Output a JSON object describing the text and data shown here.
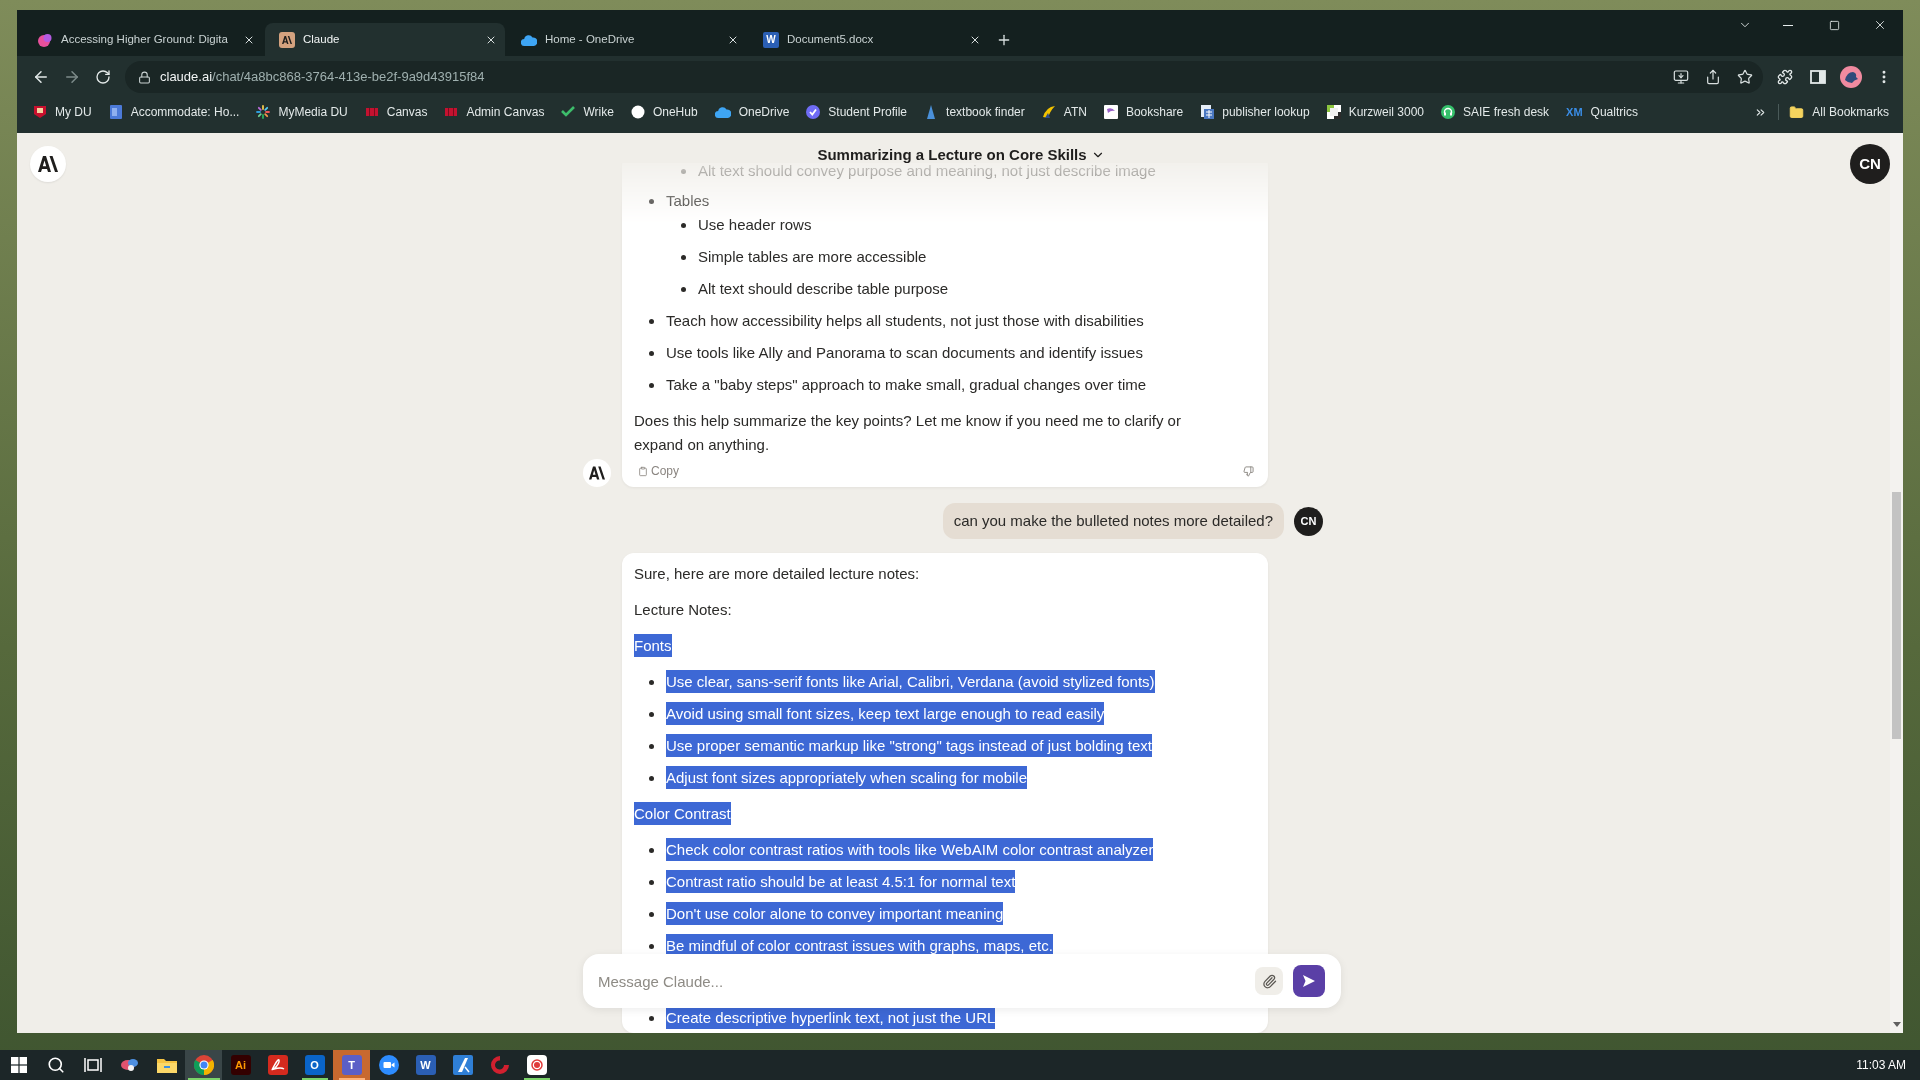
{
  "browser": {
    "tabs": [
      {
        "title": "Accessing Higher Ground: Digita",
        "selected": false
      },
      {
        "title": "Claude",
        "selected": true
      },
      {
        "title": "Home - OneDrive",
        "selected": false
      },
      {
        "title": "Document5.docx",
        "glyph": "W",
        "selected": false
      }
    ],
    "forward_disabled": true,
    "address_bar": {
      "host": "claude.ai",
      "path": "/chat/4a8bc868-3764-413e-be2f-9a9d43915f84"
    },
    "bookmarks": [
      {
        "label": "My DU"
      },
      {
        "label": "Accommodate: Ho..."
      },
      {
        "label": "MyMedia DU"
      },
      {
        "label": "Canvas"
      },
      {
        "label": "Admin Canvas"
      },
      {
        "label": "Wrike"
      },
      {
        "label": "OneHub"
      },
      {
        "label": "OneDrive"
      },
      {
        "label": "Student Profile"
      },
      {
        "label": "textbook finder"
      },
      {
        "label": "ATN"
      },
      {
        "label": "Bookshare"
      },
      {
        "label": "publisher lookup"
      },
      {
        "label": "Kurzweil 3000"
      },
      {
        "label": "SAIE fresh desk"
      },
      {
        "label": "Qualtrics",
        "glyph": "XM"
      }
    ],
    "all_bookmarks": "All Bookmarks"
  },
  "chat": {
    "title": "Summarizing a Lecture on Core Skills",
    "profile_initials": "CN",
    "messages": [
      {
        "kind": "assistant",
        "blocks": [
          {
            "kind": "list",
            "items": [
              {
                "children": [
                  {
                    "text": "Alt text should convey purpose and meaning, not just describe image"
                  }
                ]
              },
              {
                "text": "Tables",
                "children": [
                  {
                    "text": "Use header rows"
                  },
                  {
                    "text": "Simple tables are more accessible"
                  },
                  {
                    "text": "Alt text should describe table purpose"
                  }
                ]
              },
              {
                "text": "Teach how accessibility helps all students, not just those with disabilities"
              },
              {
                "text": "Use tools like Ally and Panorama to scan documents and identify issues"
              },
              {
                "text": "Take a \"baby steps\" approach to make small, gradual changes over time"
              }
            ]
          },
          {
            "kind": "paragraph",
            "text": "Does this help summarize the key points? Let me know if you need me to clarify or expand on anything."
          }
        ],
        "copy_label": "Copy"
      },
      {
        "kind": "user",
        "text": "can you make the bulleted notes more detailed?",
        "initials": "CN"
      },
      {
        "kind": "assistant",
        "blocks": [
          {
            "kind": "paragraph",
            "text": "Sure, here are more detailed lecture notes:",
            "selected": false
          },
          {
            "kind": "paragraph",
            "text": "Lecture Notes:",
            "selected": false
          },
          {
            "kind": "paragraph",
            "text": "Fonts",
            "selected": true
          },
          {
            "kind": "list",
            "items": [
              {
                "text": "Use clear, sans-serif fonts like Arial, Calibri, Verdana (avoid stylized fonts)",
                "selected": true
              },
              {
                "text": "Avoid using small font sizes, keep text large enough to read easily",
                "selected": true
              },
              {
                "text": "Use proper semantic markup like \"strong\" tags instead of just bolding text",
                "selected": true
              },
              {
                "text": "Adjust font sizes appropriately when scaling for mobile",
                "selected": true
              }
            ]
          },
          {
            "kind": "paragraph",
            "text": "Color Contrast",
            "selected": true
          },
          {
            "kind": "list",
            "items": [
              {
                "text": "Check color contrast ratios with tools like WebAIM color contrast analyzer",
                "selected": true
              },
              {
                "text": "Contrast ratio should be at least 4.5:1 for normal text",
                "selected": true
              },
              {
                "text": "Don't use color alone to convey important meaning",
                "selected": true
              },
              {
                "text": "Be mindful of color contrast issues with graphs, maps, etc.",
                "selected": true
              }
            ]
          },
          {
            "kind": "list",
            "items": [
              {
                "text": "Create descriptive hyperlink text, not just the URL",
                "selected": true
              }
            ]
          }
        ]
      }
    ],
    "composer": {
      "placeholder": "Message Claude..."
    }
  },
  "taskbar": {
    "apps": [
      {
        "open": false,
        "focused": false,
        "flashing": false
      },
      {
        "open": false,
        "focused": false,
        "flashing": false
      },
      {
        "open": false,
        "focused": false,
        "flashing": false
      },
      {
        "open": false,
        "focused": false,
        "flashing": false
      },
      {
        "open": false,
        "focused": false,
        "flashing": false
      },
      {
        "open": true,
        "focused": true,
        "flashing": false
      },
      {
        "glyph": "Ai",
        "open": false,
        "focused": false,
        "flashing": false
      },
      {
        "open": false,
        "focused": false,
        "flashing": false
      },
      {
        "glyph": "O",
        "open": true,
        "focused": false,
        "flashing": false
      },
      {
        "glyph": "T",
        "open": true,
        "focused": false,
        "flashing": true
      },
      {
        "open": false,
        "focused": false,
        "flashing": false
      },
      {
        "glyph": "W",
        "open": false,
        "focused": false,
        "flashing": false
      },
      {
        "open": false,
        "focused": false,
        "flashing": false
      },
      {
        "open": false,
        "focused": false,
        "flashing": false
      },
      {
        "open": true,
        "focused": false,
        "flashing": false
      }
    ],
    "clock": "11:03 AM"
  }
}
